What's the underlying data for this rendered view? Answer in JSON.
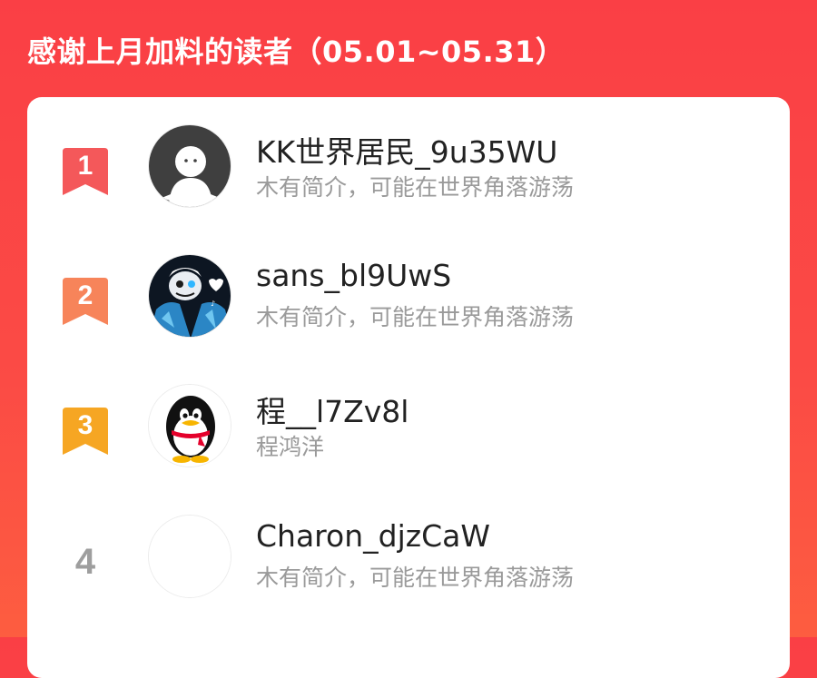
{
  "header": {
    "title": "感谢上月加料的读者（05.01~05.31）"
  },
  "colors": {
    "rank1": "#f4585a",
    "rank2": "#f7845a",
    "rank3": "#f6a623",
    "rank_other": "#9e9e9e",
    "background": "#fa3f45"
  },
  "readers": [
    {
      "rank": "1",
      "name": "KK世界居民_9u35WU",
      "bio": "木有简介，可能在世界角落游荡",
      "avatar": "default-ghost-avatar"
    },
    {
      "rank": "2",
      "name": "sans_bl9UwS",
      "bio": "木有简介，可能在世界角落游荡",
      "avatar": "sans-character-avatar"
    },
    {
      "rank": "3",
      "name": "程__l7Zv8l",
      "bio": "程鸿洋",
      "avatar": "qq-penguin-avatar"
    },
    {
      "rank": "4",
      "name": "Charon_djzCaW",
      "bio": "木有简介，可能在世界角落游荡",
      "avatar": "blank-avatar"
    }
  ]
}
